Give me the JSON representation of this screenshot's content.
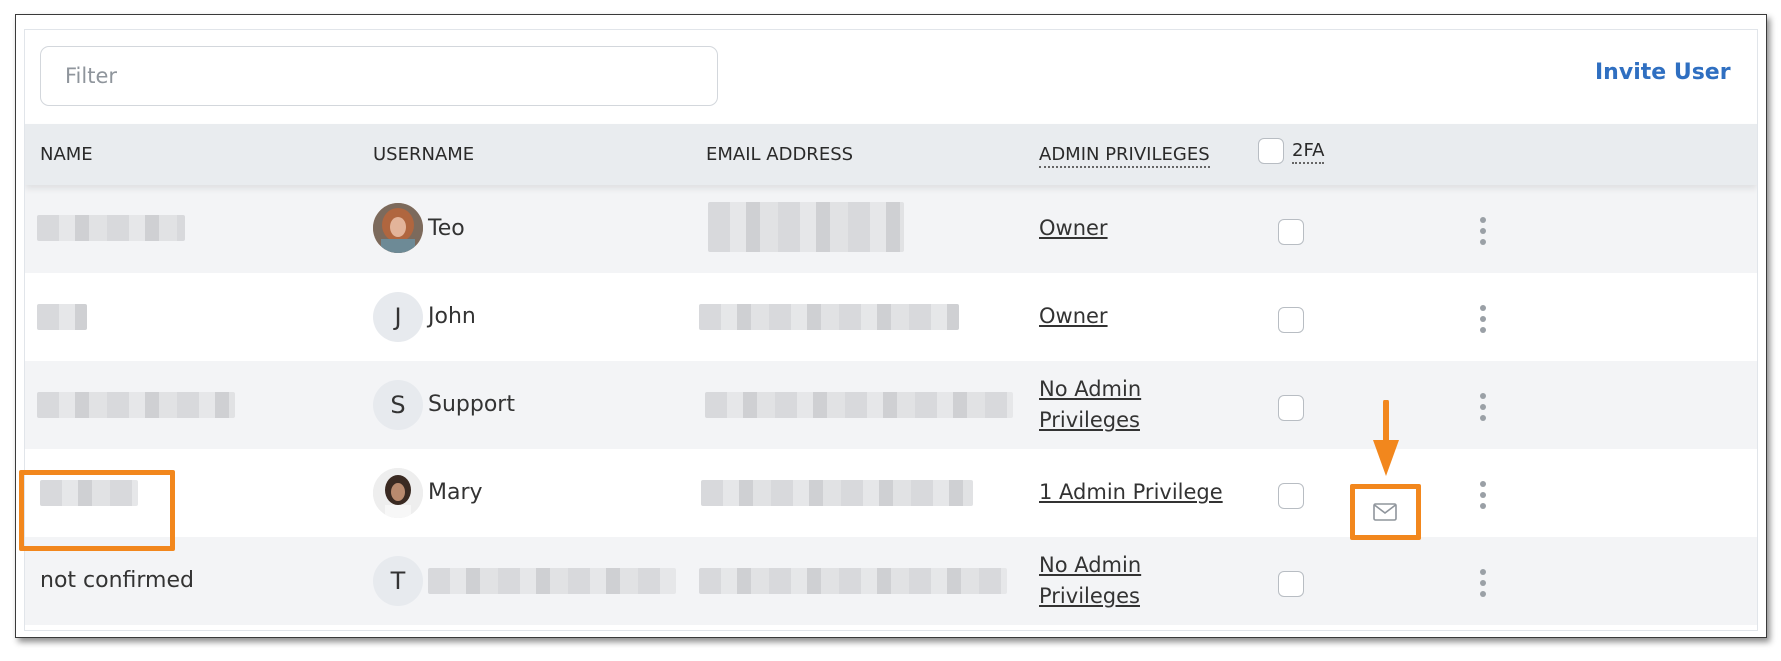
{
  "toolbar": {
    "filter_placeholder": "Filter",
    "invite_label": "Invite User"
  },
  "table": {
    "headers": {
      "name": "NAME",
      "username": "USERNAME",
      "email": "EMAIL ADDRESS",
      "admin": "ADMIN PRIVILEGES",
      "twofa": "2FA"
    },
    "rows": [
      {
        "name": "",
        "avatar": "photo",
        "username": "Teo",
        "email": "",
        "admin": "Owner"
      },
      {
        "name": "",
        "avatar": "J",
        "username": "John",
        "email": "",
        "admin": "Owner"
      },
      {
        "name": "",
        "avatar": "S",
        "username": "Support",
        "email": "",
        "admin": "No Admin Privileges"
      },
      {
        "name": "",
        "avatar": "photo",
        "username": "Mary",
        "email": "",
        "admin": "1 Admin Privilege"
      },
      {
        "name": "not confirmed",
        "avatar": "T",
        "username": "",
        "email": "",
        "admin": "No Admin Privileges",
        "resend_icon": "envelope-icon"
      }
    ]
  },
  "annotations": {
    "color": "#f2871d"
  },
  "colors": {
    "accent": "#2f6fc1",
    "header_bg": "#e9ecef"
  }
}
